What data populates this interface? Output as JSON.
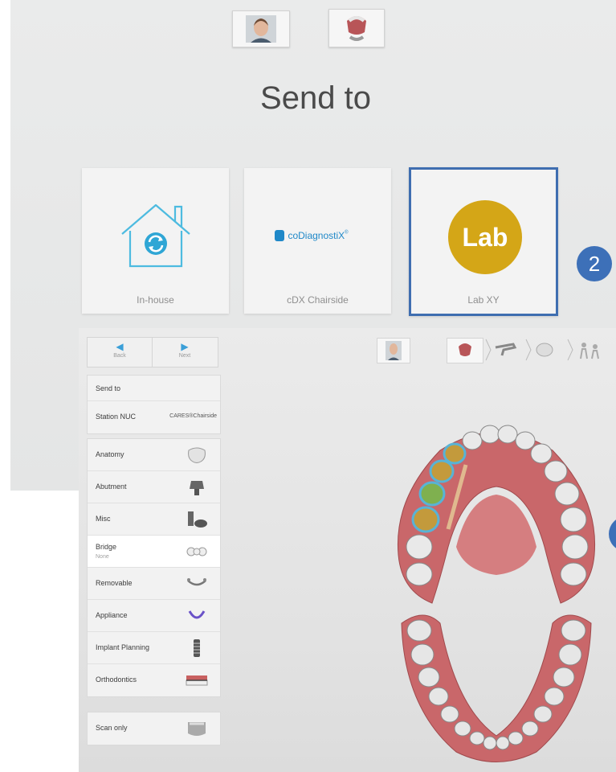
{
  "top": {
    "title": "Send to",
    "destinations": [
      {
        "label": "In-house",
        "icon": "house-sync-icon"
      },
      {
        "label": "cDX Chairside",
        "logo_text": "coDiagnostiX",
        "logo_mark": "®"
      },
      {
        "label": "Lab XY",
        "circle_text": "Lab",
        "selected": true
      }
    ],
    "step_badge": "2"
  },
  "bottom": {
    "nav": {
      "back": "Back",
      "next": "Next"
    },
    "send_to_header": "Send to",
    "station": {
      "label": "Station NUC",
      "logo": "CARES®Chairside"
    },
    "menu": [
      {
        "label": "Anatomy",
        "icon": "crown-icon"
      },
      {
        "label": "Abutment",
        "icon": "abutment-icon"
      },
      {
        "label": "Misc",
        "icon": "misc-icon"
      },
      {
        "label": "Bridge",
        "sub": "None",
        "icon": "bridge-icon",
        "active": true
      },
      {
        "label": "Removable",
        "icon": "removable-icon"
      },
      {
        "label": "Appliance",
        "icon": "appliance-icon"
      },
      {
        "label": "Implant Planning",
        "icon": "implant-icon"
      },
      {
        "label": "Orthodontics",
        "icon": "brackets-icon"
      }
    ],
    "scan_only": "Scan only"
  },
  "colors": {
    "accent_blue": "#3d70b8",
    "lab_gold": "#d4a617",
    "icon_blue": "#3a9fd8",
    "gum": "#c9676a"
  }
}
